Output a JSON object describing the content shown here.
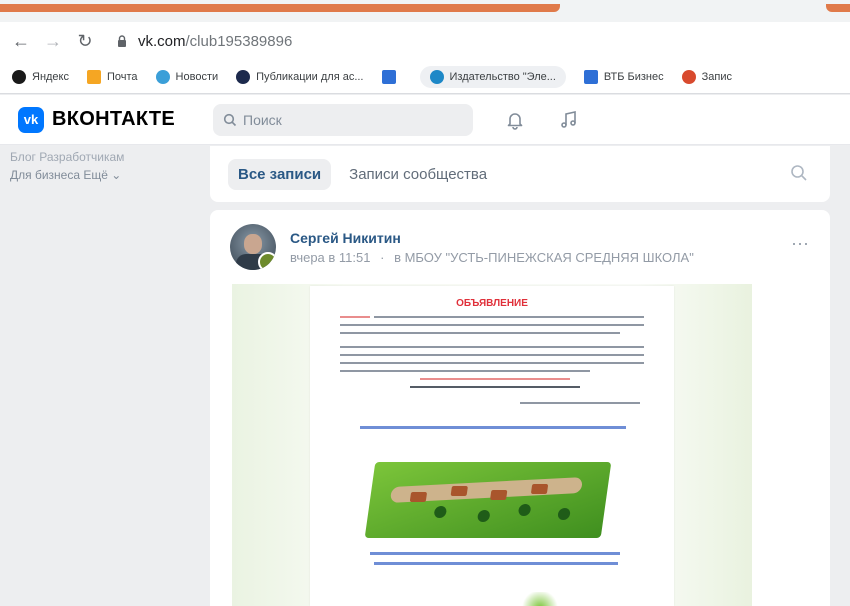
{
  "browser": {
    "url_host": "vk.com",
    "url_path": "/club195389896",
    "colors": {
      "tab_accent": "#e07a4a"
    },
    "bookmarks": [
      {
        "label": "Яндекс",
        "icon": "yandex-icon"
      },
      {
        "label": "Почта",
        "icon": "mail-icon"
      },
      {
        "label": "Новости",
        "icon": "news-icon"
      },
      {
        "label": "Публикации для ас...",
        "icon": "publications-icon"
      },
      {
        "label": "",
        "icon": "bookmark-folder-icon"
      },
      {
        "label": "Издательство \"Эле...",
        "icon": "publisher-icon"
      },
      {
        "label": "ВТБ Бизнес",
        "icon": "vtb-icon"
      },
      {
        "label": "Запис",
        "icon": "record-icon"
      }
    ]
  },
  "vk": {
    "logo_text": "ВКОНТАКТЕ",
    "logo_mark": "vk",
    "search_placeholder": "Поиск",
    "colors": {
      "brand": "#0077ff",
      "link": "#2a5885"
    }
  },
  "sidebar": {
    "row1": "Блог  Разработчикам",
    "row2": "Для бизнеса  Ещё ⌄"
  },
  "feed": {
    "tabs": [
      {
        "label": "Все записи",
        "active": true
      },
      {
        "label": "Записи сообщества",
        "active": false
      }
    ]
  },
  "post": {
    "author": "Сергей Никитин",
    "time": "вчера в 11:51",
    "separator": "·",
    "context": "в МБОУ \"УСТЬ-ПИНЕЖСКАЯ СРЕДНЯЯ ШКОЛА\"",
    "image_title": "ОБЪЯВЛЕНИЕ"
  }
}
